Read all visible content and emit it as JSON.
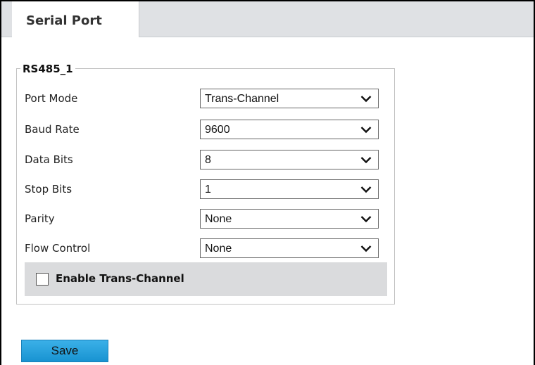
{
  "tabs": [
    {
      "label": "Serial Port",
      "active": true
    }
  ],
  "section": {
    "legend": "RS485_1"
  },
  "fields": [
    {
      "label": "Port Mode",
      "value": "Trans-Channel"
    },
    {
      "label": "Baud Rate",
      "value": "9600"
    },
    {
      "label": "Data Bits",
      "value": "8"
    },
    {
      "label": "Stop Bits",
      "value": "1"
    },
    {
      "label": "Parity",
      "value": "None"
    },
    {
      "label": "Flow Control",
      "value": "None"
    }
  ],
  "enable_trans_channel": {
    "label": "Enable Trans-Channel",
    "checked": false
  },
  "save_label": "Save",
  "icons": {
    "dropdown": "chevron-down-icon"
  },
  "colors": {
    "save_button": "#1a9ad6",
    "tabbar": "#dfe1e4",
    "enable_panel": "#dadbdd"
  }
}
